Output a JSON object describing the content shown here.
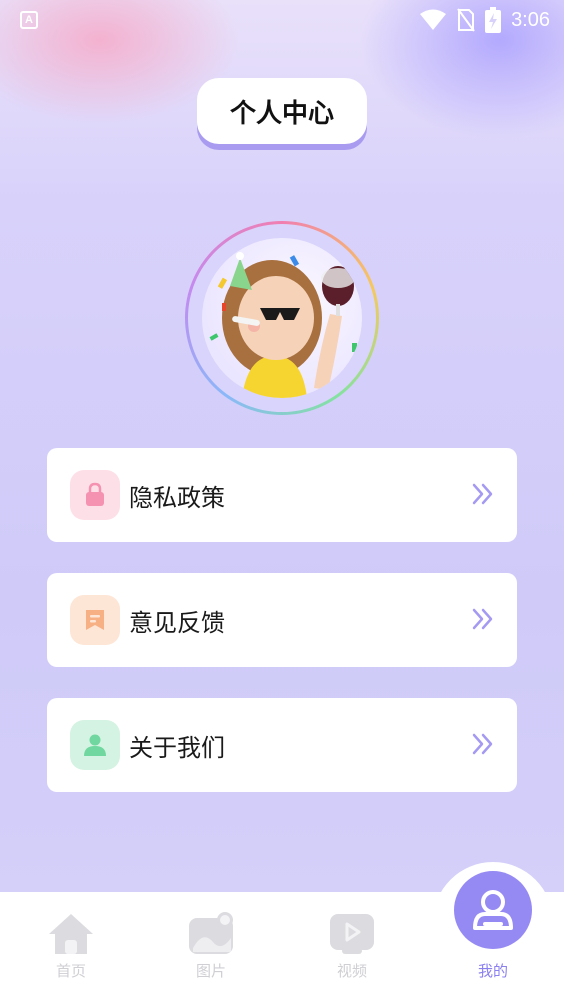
{
  "status_bar": {
    "app_icon_letter": "A",
    "time": "3:06",
    "icons": [
      "wifi-icon",
      "no-sim-icon",
      "battery-charging-icon"
    ]
  },
  "header": {
    "title": "个人中心"
  },
  "profile": {
    "avatar_icon": "party-girl-avatar"
  },
  "menu": {
    "items": [
      {
        "label": "隐私政策",
        "icon": "lock-icon",
        "icon_bg": "#fde0e7",
        "icon_color": "#f592b2"
      },
      {
        "label": "意见反馈",
        "icon": "feedback-icon",
        "icon_bg": "#fde6d6",
        "icon_color": "#f6b084"
      },
      {
        "label": "关于我们",
        "icon": "user-icon",
        "icon_bg": "#d5f3e2",
        "icon_color": "#6fd79f"
      }
    ],
    "chevron_icon": "double-chevron-right-icon",
    "chevron_color": "#a59af2"
  },
  "tabbar": {
    "tabs": [
      {
        "label": "首页",
        "icon": "home-icon",
        "active": false
      },
      {
        "label": "图片",
        "icon": "image-icon",
        "active": false
      },
      {
        "label": "视频",
        "icon": "video-icon",
        "active": false
      },
      {
        "label": "我的",
        "icon": "profile-icon",
        "active": true
      }
    ],
    "active_color": "#8b80f0",
    "inactive_color": "#cfcfd4"
  }
}
